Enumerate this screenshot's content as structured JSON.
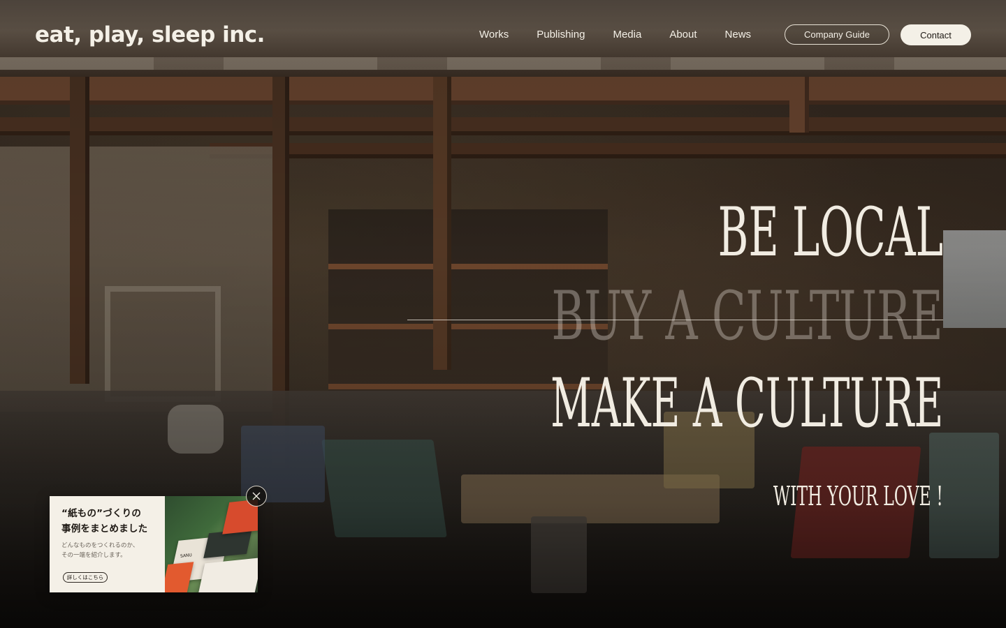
{
  "header": {
    "logo_text": "eat, play, sleep inc.",
    "nav": [
      "Works",
      "Publishing",
      "Media",
      "About",
      "News"
    ],
    "company_guide_label": "Company Guide",
    "contact_label": "Contact"
  },
  "hero": {
    "line1": "BE LOCAL",
    "line2": "BUY A CULTURE",
    "line3": "MAKE A CULTURE",
    "line4": "WITH YOUR LOVE !"
  },
  "promo": {
    "title_line1": "“紙もの”づくりの",
    "title_line2": "事例をまとめました",
    "desc_line1": "どんなものをつくれるのか、",
    "desc_line2": "その一端を紹介します。",
    "more_label": "詳しくはこちら",
    "thumb_label": "SANU",
    "close_icon": "close-icon"
  },
  "colors": {
    "text_light": "#f4f0e7",
    "button_bg": "#f4f0e7",
    "button_text": "#1f1a15",
    "overlay_dark": "#1d1a16"
  }
}
